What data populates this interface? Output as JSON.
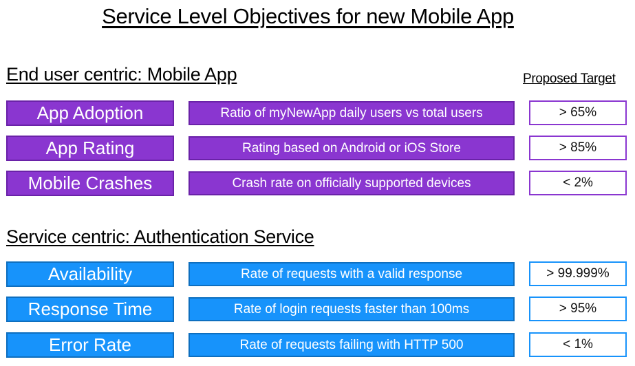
{
  "title": "Service Level Objectives for new Mobile App",
  "target_header": "Proposed Target",
  "sections": [
    {
      "heading": "End user centric: Mobile App",
      "color": "#8a36d0",
      "rows": [
        {
          "name": "App Adoption",
          "description": "Ratio of myNewApp daily users vs total users",
          "target": "> 65%"
        },
        {
          "name": "App Rating",
          "description": "Rating based on Android or iOS Store",
          "target": "> 85%"
        },
        {
          "name": "Mobile Crashes",
          "description": "Crash rate on officially supported devices",
          "target": "< 2%"
        }
      ]
    },
    {
      "heading": "Service centric: Authentication Service",
      "color": "#1793fb",
      "rows": [
        {
          "name": "Availability",
          "description": "Rate of requests with a valid response",
          "target": "> 99.999%"
        },
        {
          "name": "Response Time",
          "description": "Rate of login requests faster than 100ms",
          "target": "> 95%"
        },
        {
          "name": "Error Rate",
          "description": "Rate of requests failing with HTTP 500",
          "target": "< 1%"
        }
      ]
    }
  ]
}
